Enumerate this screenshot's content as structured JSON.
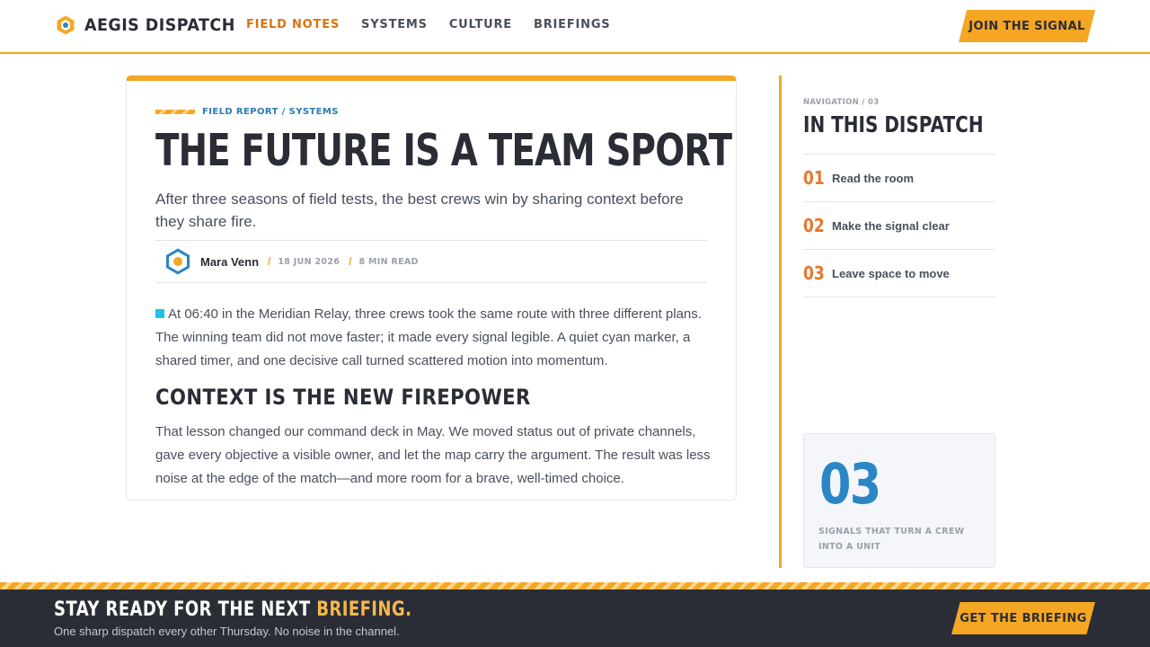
{
  "brand": {
    "name": "AEGIS DISPATCH",
    "icon": "hexagon-logo-icon",
    "colors": {
      "accent": "#f5a623",
      "accent_dark": "#d9730d",
      "link_blue": "#2b7bb0",
      "stat_blue": "#2b86c5",
      "cyan": "#1fc1e8",
      "ink": "#2a2d36"
    }
  },
  "nav": {
    "items": [
      {
        "label": "FIELD NOTES",
        "active": true
      },
      {
        "label": "SYSTEMS",
        "active": false
      },
      {
        "label": "CULTURE",
        "active": false
      },
      {
        "label": "BRIEFINGS",
        "active": false
      }
    ],
    "cta": "JOIN THE SIGNAL"
  },
  "article": {
    "kicker": "FIELD REPORT / SYSTEMS",
    "title": "THE FUTURE IS A TEAM SPORT",
    "subtitle": "After three seasons of field tests, the best crews win by sharing context before they share fire.",
    "author": "Mara Venn",
    "date": "18 JUN 2026",
    "read_time": "8 MIN READ",
    "lead": "At 06:40 in the Meridian Relay, three crews took the same route with three different plans. The winning team did not move faster; it made every signal legible. A quiet cyan marker, a shared timer, and one decisive call turned scattered motion into momentum.",
    "section_title": "CONTEXT IS THE NEW FIREPOWER",
    "body": "That lesson changed our command deck in May. We moved status out of private channels, gave every objective a visible owner, and let the map carry the argument. The result was less noise at the edge of the match—and more room for a brave, well-timed choice."
  },
  "sidebar": {
    "kicker": "NAVIGATION / 03",
    "title": "IN THIS DISPATCH",
    "items": [
      {
        "num": "01",
        "label": "Read the room"
      },
      {
        "num": "02",
        "label": "Make the signal clear"
      },
      {
        "num": "03",
        "label": "Leave space to move"
      }
    ],
    "stat": {
      "value": "03",
      "label": "SIGNALS THAT TURN A CREW INTO A UNIT"
    }
  },
  "footer": {
    "title_main": "STAY READY FOR THE NEXT ",
    "title_accent": "BRIEFING.",
    "subtitle": "One sharp dispatch every other Thursday. No noise in the channel.",
    "cta": "GET THE BRIEFING"
  }
}
